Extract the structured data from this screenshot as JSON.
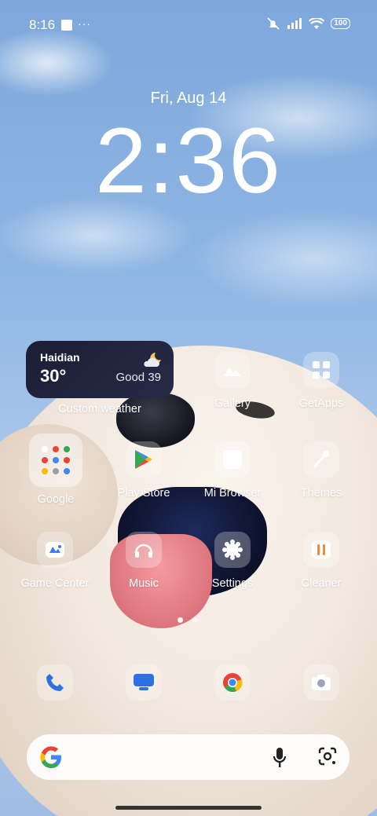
{
  "status_bar": {
    "time": "8:16",
    "more": "···",
    "battery": "100"
  },
  "lockscreen": {
    "date": "Fri, Aug 14",
    "clock": "2:36"
  },
  "weather_widget": {
    "city": "Haidian",
    "temperature": "30°",
    "air_quality": "Good 39",
    "label": "Custom weather"
  },
  "apps": {
    "gallery": "Gallery",
    "getapps": "GetApps",
    "google": "Google",
    "play_store": "Play Store",
    "mi_browser": "Mi Browser",
    "themes": "Themes",
    "game_center": "Game Center",
    "music": "Music",
    "settings": "Settings",
    "cleaner": "Cleaner"
  },
  "dock": [
    "phone-icon",
    "messages-icon",
    "chrome-icon",
    "camera-icon"
  ],
  "page_indicator": {
    "pages": 2,
    "current": 1
  },
  "colors": {
    "accent_orange": "#f08a3c",
    "widget_bg": "#1b1e34",
    "chrome_red": "#ea4335",
    "chrome_yellow": "#fbbc05",
    "chrome_green": "#34a853",
    "chrome_blue": "#4285f4"
  }
}
